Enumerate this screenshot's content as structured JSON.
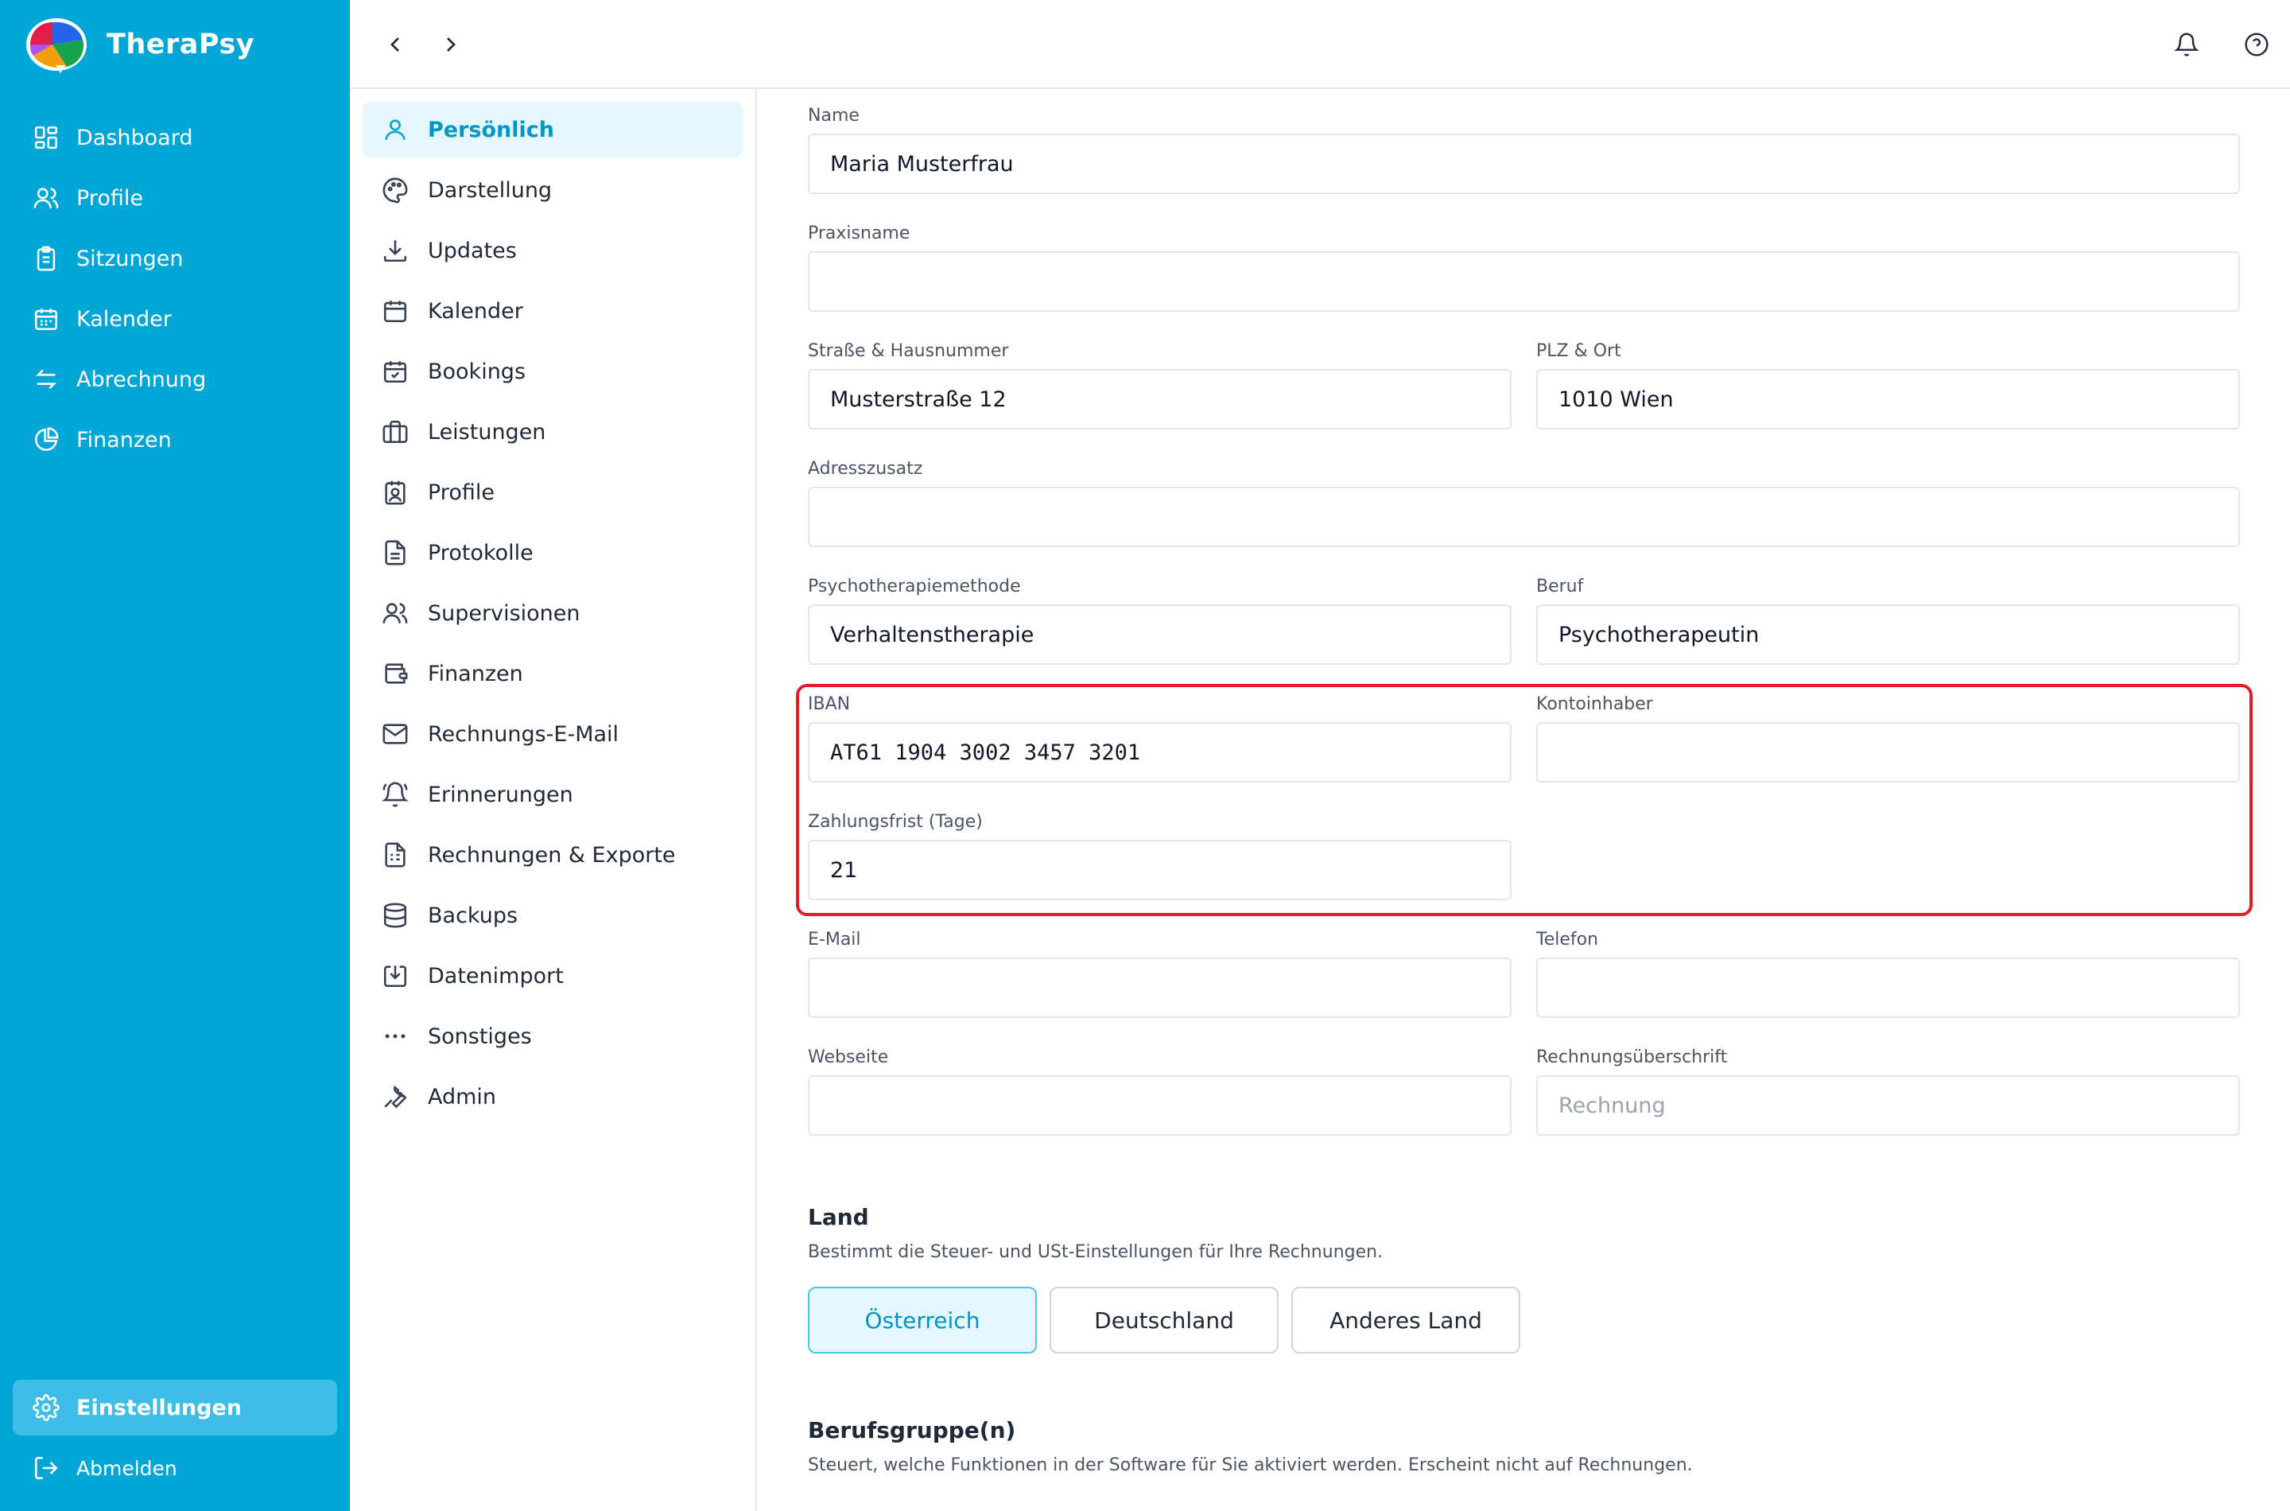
{
  "app": {
    "name": "TheraPsy",
    "accent": "#00a7d6",
    "highlight_color": "#e11d2a"
  },
  "sidebar": {
    "items": [
      {
        "label": "Dashboard",
        "icon": "dashboard-grid-icon"
      },
      {
        "label": "Profile",
        "icon": "users-icon"
      },
      {
        "label": "Sitzungen",
        "icon": "clipboard-icon"
      },
      {
        "label": "Kalender",
        "icon": "calendar-icon"
      },
      {
        "label": "Abrechnung",
        "icon": "arrows-exchange-icon"
      },
      {
        "label": "Finanzen",
        "icon": "pie-chart-icon"
      }
    ],
    "settings_label": "Einstellungen",
    "logout_label": "Abmelden"
  },
  "topbar": {
    "back_icon": "chevron-left-icon",
    "forward_icon": "chevron-right-icon",
    "notifications_icon": "bell-icon",
    "help_icon": "help-circle-icon"
  },
  "submenu": {
    "items": [
      {
        "label": "Persönlich",
        "icon": "user-icon",
        "active": true
      },
      {
        "label": "Darstellung",
        "icon": "palette-icon"
      },
      {
        "label": "Updates",
        "icon": "download-icon"
      },
      {
        "label": "Kalender",
        "icon": "calendar-icon"
      },
      {
        "label": "Bookings",
        "icon": "calendar-check-icon"
      },
      {
        "label": "Leistungen",
        "icon": "briefcase-icon"
      },
      {
        "label": "Profile",
        "icon": "contact-card-icon"
      },
      {
        "label": "Protokolle",
        "icon": "document-icon"
      },
      {
        "label": "Supervisionen",
        "icon": "users-icon"
      },
      {
        "label": "Finanzen",
        "icon": "wallet-icon"
      },
      {
        "label": "Rechnungs-E-Mail",
        "icon": "mail-icon"
      },
      {
        "label": "Erinnerungen",
        "icon": "bell-ring-icon"
      },
      {
        "label": "Rechnungen & Exporte",
        "icon": "invoice-icon"
      },
      {
        "label": "Backups",
        "icon": "database-icon"
      },
      {
        "label": "Datenimport",
        "icon": "import-icon"
      },
      {
        "label": "Sonstiges",
        "icon": "more-horizontal-icon"
      },
      {
        "label": "Admin",
        "icon": "wrench-icon"
      }
    ]
  },
  "form": {
    "name": {
      "label": "Name",
      "value": "Maria Musterfrau"
    },
    "praxisname": {
      "label": "Praxisname",
      "value": ""
    },
    "strasse": {
      "label": "Straße & Hausnummer",
      "value": "Musterstraße 12"
    },
    "plz_ort": {
      "label": "PLZ & Ort",
      "value": "1010 Wien"
    },
    "adresszusatz": {
      "label": "Adresszusatz",
      "value": ""
    },
    "methode": {
      "label": "Psychotherapiemethode",
      "value": "Verhaltenstherapie"
    },
    "beruf": {
      "label": "Beruf",
      "value": "Psychotherapeutin"
    },
    "iban": {
      "label": "IBAN",
      "value": "AT61 1904 3002 3457 3201"
    },
    "kontoinhaber": {
      "label": "Kontoinhaber",
      "value": ""
    },
    "zahlungsfrist": {
      "label": "Zahlungsfrist (Tage)",
      "value": "21"
    },
    "email": {
      "label": "E-Mail",
      "value": ""
    },
    "telefon": {
      "label": "Telefon",
      "value": ""
    },
    "webseite": {
      "label": "Webseite",
      "value": ""
    },
    "rechnungsueberschrift": {
      "label": "Rechnungsüberschrift",
      "placeholder": "Rechnung"
    }
  },
  "land": {
    "title": "Land",
    "description": "Bestimmt die Steuer- und USt-Einstellungen für Ihre Rechnungen.",
    "options": [
      "Österreich",
      "Deutschland",
      "Anderes Land"
    ],
    "selected": "Österreich"
  },
  "berufsgruppe": {
    "title": "Berufsgruppe(n)",
    "description": "Steuert, welche Funktionen in der Software für Sie aktiviert werden. Erscheint nicht auf Rechnungen."
  }
}
